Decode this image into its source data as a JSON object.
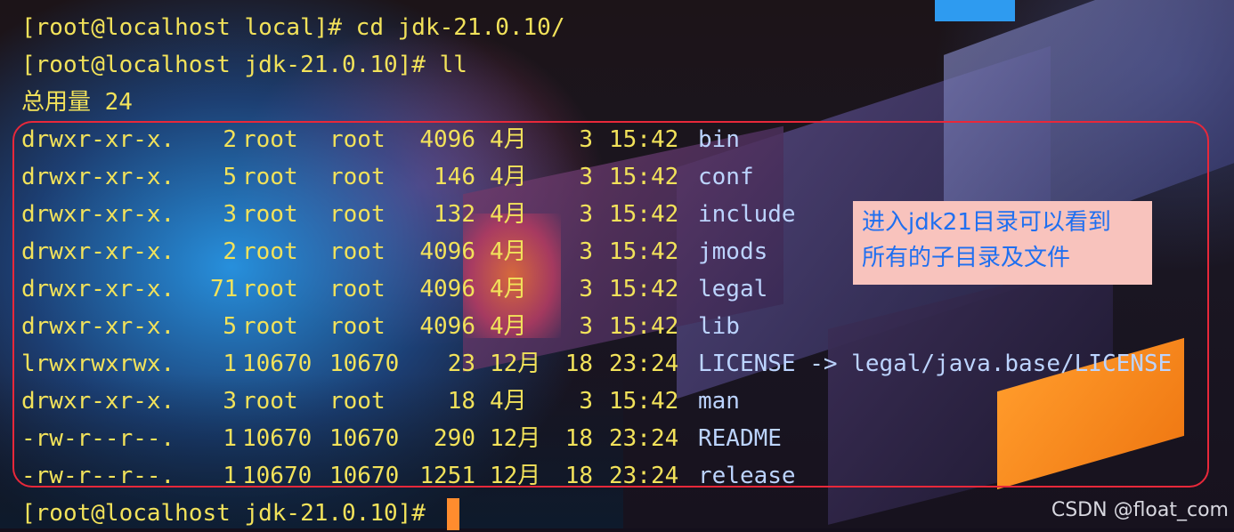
{
  "terminal": {
    "line1": "[root@localhost local]# cd jdk-21.0.10/",
    "line2": "[root@localhost jdk-21.0.10]# ll",
    "total": "总用量 24",
    "last_prompt": "[root@localhost jdk-21.0.10]# "
  },
  "listing": {
    "rows": [
      {
        "perm": "drwxr-xr-x.",
        "links": "2",
        "user": "root",
        "group": "root",
        "size": "4096",
        "month": "4月",
        "day": "3",
        "time": "15:42",
        "name": "bin"
      },
      {
        "perm": "drwxr-xr-x.",
        "links": "5",
        "user": "root",
        "group": "root",
        "size": "146",
        "month": "4月",
        "day": "3",
        "time": "15:42",
        "name": "conf"
      },
      {
        "perm": "drwxr-xr-x.",
        "links": "3",
        "user": "root",
        "group": "root",
        "size": "132",
        "month": "4月",
        "day": "3",
        "time": "15:42",
        "name": "include"
      },
      {
        "perm": "drwxr-xr-x.",
        "links": "2",
        "user": "root",
        "group": "root",
        "size": "4096",
        "month": "4月",
        "day": "3",
        "time": "15:42",
        "name": "jmods"
      },
      {
        "perm": "drwxr-xr-x.",
        "links": "71",
        "user": "root",
        "group": "root",
        "size": "4096",
        "month": "4月",
        "day": "3",
        "time": "15:42",
        "name": "legal"
      },
      {
        "perm": "drwxr-xr-x.",
        "links": "5",
        "user": "root",
        "group": "root",
        "size": "4096",
        "month": "4月",
        "day": "3",
        "time": "15:42",
        "name": "lib"
      },
      {
        "perm": "lrwxrwxrwx.",
        "links": "1",
        "user": "10670",
        "group": "10670",
        "size": "23",
        "month": "12月",
        "day": "18",
        "time": "23:24",
        "name": "LICENSE -> legal/java.base/LICENSE"
      },
      {
        "perm": "drwxr-xr-x.",
        "links": "3",
        "user": "root",
        "group": "root",
        "size": "18",
        "month": "4月",
        "day": "3",
        "time": "15:42",
        "name": "man"
      },
      {
        "perm": "-rw-r--r--.",
        "links": "1",
        "user": "10670",
        "group": "10670",
        "size": "290",
        "month": "12月",
        "day": "18",
        "time": "23:24",
        "name": "README"
      },
      {
        "perm": "-rw-r--r--.",
        "links": "1",
        "user": "10670",
        "group": "10670",
        "size": "1251",
        "month": "12月",
        "day": "18",
        "time": "23:24",
        "name": "release"
      }
    ]
  },
  "annotation": {
    "line1": "进入jdk21目录可以看到",
    "line2": "所有的子目录及文件"
  },
  "watermark": "CSDN @float_com",
  "colors": {
    "terminal_text": "#f2e25a",
    "filename_text": "#bcd4ff",
    "cursor": "#ff8c2e",
    "highlight_border": "#e8283a",
    "note_bg": "#f8c3bd",
    "note_text": "#1f6ff0"
  }
}
